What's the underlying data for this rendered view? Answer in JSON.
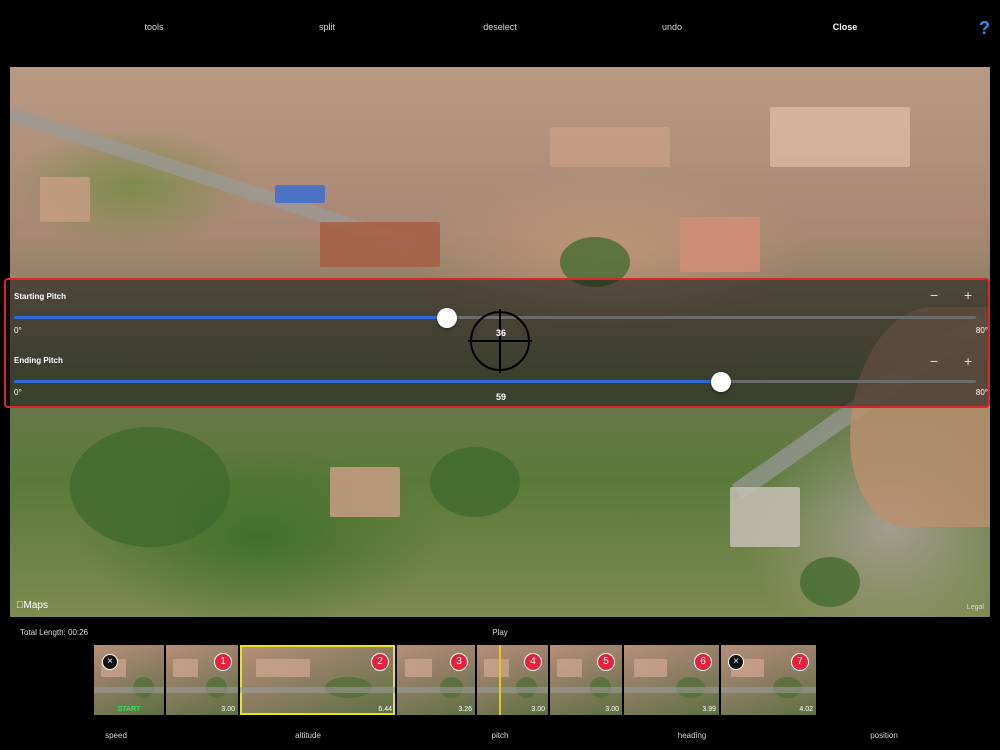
{
  "toolbar": {
    "tools": "tools",
    "split": "split",
    "deselect": "deselect",
    "undo": "undo",
    "close": "Close",
    "help": "?"
  },
  "map": {
    "logo": "Maps",
    "legal": "Legal"
  },
  "pitch": {
    "start_label": "Starting Pitch",
    "start_value": "36",
    "start_fraction": 0.45,
    "end_label": "Ending Pitch",
    "end_value": "59",
    "end_fraction": 0.735,
    "min": "0°",
    "max": "80°",
    "minus": "−",
    "plus": "+",
    "track_color": "#2f6bd8"
  },
  "timeline": {
    "total_length": "Total Length: 00:26",
    "play": "Play",
    "start_label": "START",
    "clips": [
      {
        "number": "1",
        "duration": "3.00"
      },
      {
        "number": "2",
        "duration": "6.44"
      },
      {
        "number": "3",
        "duration": "3.26"
      },
      {
        "number": "4",
        "duration": "3.00"
      },
      {
        "number": "5",
        "duration": "3.00"
      },
      {
        "number": "6",
        "duration": "3.99"
      },
      {
        "number": "7",
        "duration": "4.02"
      }
    ],
    "selected_clip": "2"
  },
  "bottom_tabs": {
    "speed": "speed",
    "altitude": "altitude",
    "pitch": "pitch",
    "heading": "heading",
    "position": "position"
  }
}
